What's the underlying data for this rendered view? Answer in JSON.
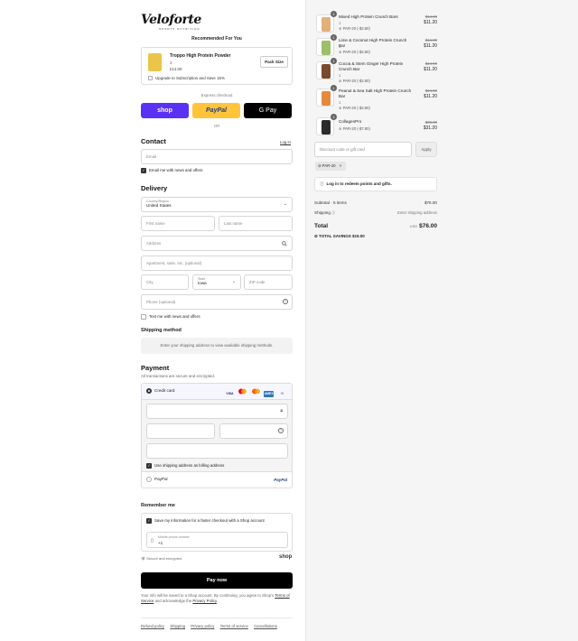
{
  "brand": {
    "name": "Veloforte",
    "tagline": "SPORTS NUTRITION"
  },
  "recommended": {
    "title": "Recommended For You",
    "product_name": "Troppo High Protein Powder",
    "qty": "3",
    "price": "£14.00",
    "pack_size_label": "Pack Size",
    "subscription_label": "Upgrade to Subscription and Save 15%"
  },
  "express": {
    "title": "Express checkout",
    "shop_label": "shop",
    "paypal_label": "PayPal",
    "gpay_label": "G Pay",
    "or_label": "OR"
  },
  "contact": {
    "title": "Contact",
    "login_label": "Log in",
    "email_placeholder": "Email",
    "news_label": "Email me with news and offers"
  },
  "delivery": {
    "title": "Delivery",
    "country_label": "Country/Region",
    "country_value": "United States",
    "first_name_placeholder": "First name",
    "last_name_placeholder": "Last name",
    "address_placeholder": "Address",
    "apartment_placeholder": "Apartment, suite, etc. (optional)",
    "city_placeholder": "City",
    "state_label": "State",
    "state_value": "Iowa",
    "zip_placeholder": "ZIP code",
    "phone_placeholder": "Phone (optional)",
    "text_label": "Text me with news and offers"
  },
  "shipping": {
    "title": "Shipping method",
    "note": "Enter your shipping address to view available shipping methods."
  },
  "payment": {
    "title": "Payment",
    "subtitle": "All transactions are secure and encrypted.",
    "credit_card_label": "Credit card",
    "card_brands": [
      "VISA",
      "MC",
      "MC",
      "AMEX"
    ],
    "more_label": "+5",
    "billing_label": "Use shipping address as billing address",
    "paypal_label": "PayPal",
    "paypal_logo": "PayPal"
  },
  "remember": {
    "title": "Remember me",
    "save_label": "Save my information for a faster checkout with a Shop account",
    "phone_label": "Mobile phone number",
    "phone_value": "+1",
    "secure_label": "Secure and encrypted",
    "shop_logo": "shop"
  },
  "pay_now_label": "Pay now",
  "legal": {
    "text1": "Your info will be saved to a Shop account. By continuing, you agree to Shop's",
    "terms_label": "Terms of Service",
    "text2": "and acknowledge the",
    "privacy_label": "Privacy Policy",
    "text3": "."
  },
  "footer_links": [
    "Refund policy",
    "Shipping",
    "Privacy policy",
    "Terms of service",
    "Cancellations"
  ],
  "cart": {
    "items": [
      {
        "name": "Mixed High Protein Crunch Bars",
        "qty": "1",
        "discount": "PAR-20 (-$2.80)",
        "old_price": "$14.00",
        "price": "$11.20",
        "badge": "1",
        "color": "#e2b07a"
      },
      {
        "name": "Lime & Coconut High Protein Crunch Bar",
        "qty": "1",
        "discount": "PAR-20 (-$2.80)",
        "old_price": "$14.00",
        "price": "$11.20",
        "badge": "1",
        "color": "#9bbf6a"
      },
      {
        "name": "Cocoa & Stem Ginger High Protein Crunch Bar",
        "qty": "1",
        "discount": "PAR-20 (-$2.80)",
        "old_price": "$14.00",
        "price": "$11.20",
        "badge": "1",
        "color": "#7a4a2c"
      },
      {
        "name": "Peanut & Sea Salt High Protein Crunch Bar",
        "qty": "1",
        "discount": "PAR-20 (-$2.80)",
        "old_price": "$14.00",
        "price": "$11.20",
        "badge": "1",
        "color": "#e58a3c"
      },
      {
        "name": "CollagenPro",
        "qty": "",
        "discount": "PAR-20 (-$7.80)",
        "old_price": "$39.00",
        "price": "$31.20",
        "badge": "1",
        "color": "#2b2b2b"
      }
    ],
    "discount_placeholder": "Discount code or gift card",
    "apply_label": "Apply",
    "code_chip": "PAR-20",
    "login_rewards": "Log in to redeem points and gifts.",
    "subtotal_label": "Subtotal · 5 items",
    "subtotal_value": "$76.00",
    "shipping_label": "Shipping",
    "shipping_value": "Enter shipping address",
    "total_label": "Total",
    "total_currency": "USD",
    "total_value": "$76.00",
    "savings_label": "TOTAL SAVINGS",
    "savings_value": "$19.00"
  }
}
